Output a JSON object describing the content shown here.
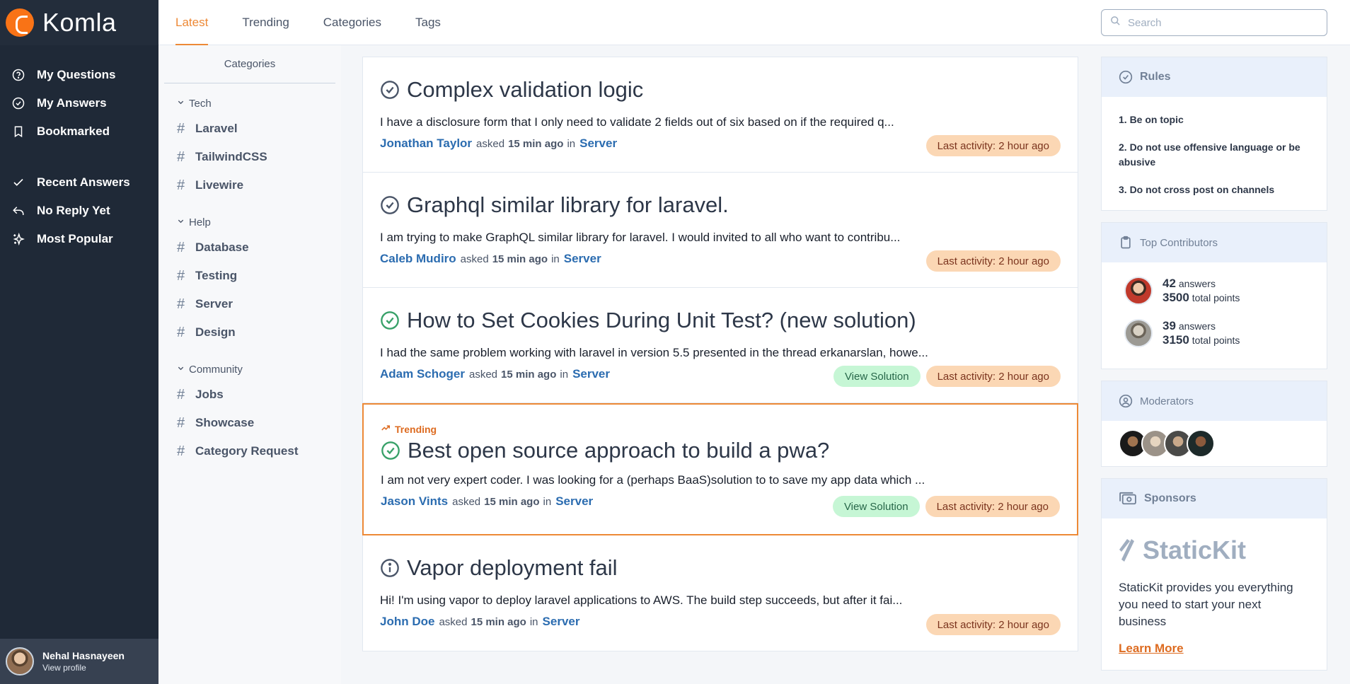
{
  "app": {
    "name": "Komla"
  },
  "nav": {
    "primary": [
      {
        "label": "My Questions",
        "icon": "question-circle-icon"
      },
      {
        "label": "My Answers",
        "icon": "check-circle-icon"
      },
      {
        "label": "Bookmarked",
        "icon": "bookmark-icon"
      }
    ],
    "secondary": [
      {
        "label": "Recent Answers",
        "icon": "check-icon"
      },
      {
        "label": "No Reply Yet",
        "icon": "reply-icon"
      },
      {
        "label": "Most Popular",
        "icon": "sparkle-icon"
      }
    ]
  },
  "profile": {
    "name": "Nehal Hasnayeen",
    "link": "View profile"
  },
  "tabs": [
    "Latest",
    "Trending",
    "Categories",
    "Tags"
  ],
  "active_tab": "Latest",
  "search": {
    "placeholder": "Search"
  },
  "categories": {
    "title": "Categories",
    "groups": [
      {
        "name": "Tech",
        "items": [
          "Laravel",
          "TailwindCSS",
          "Livewire"
        ]
      },
      {
        "name": "Help",
        "items": [
          "Database",
          "Testing",
          "Server",
          "Design"
        ]
      },
      {
        "name": "Community",
        "items": [
          "Jobs",
          "Showcase",
          "Category Request"
        ]
      }
    ]
  },
  "posts": [
    {
      "title": "Complex validation logic",
      "status": "answered",
      "excerpt": "I have a disclosure form that I only need to validate 2 fields out of six based on if the required q...",
      "author": "Jonathan Taylor",
      "asked": "asked",
      "time": "15 min ago",
      "in": "in",
      "channel": "Server",
      "solution": "",
      "activity": "Last activity: 2 hour ago"
    },
    {
      "title": "Graphql similar library for laravel.",
      "status": "answered",
      "excerpt": "I am trying to make GraphQL similar library for laravel. I would invited to all who want to contribu...",
      "author": "Caleb Mudiro",
      "asked": "asked",
      "time": "15 min ago",
      "in": "in",
      "channel": "Server",
      "solution": "",
      "activity": "Last activity: 2 hour ago"
    },
    {
      "title": "How to Set Cookies During Unit Test? (new solution)",
      "status": "solved",
      "excerpt": "I had the same problem working with laravel in version 5.5 presented in the thread erkanarslan, howe...",
      "author": "Adam Schoger",
      "asked": "asked",
      "time": "15 min ago",
      "in": "in",
      "channel": "Server",
      "solution": "View Solution",
      "activity": "Last activity: 2 hour ago"
    },
    {
      "title": "Best open source approach to build a pwa?",
      "status": "solved",
      "trending": "Trending",
      "excerpt": "I am not very expert coder. I was looking for a (perhaps BaaS)solution to to save my app data which ...",
      "author": "Jason Vints",
      "asked": "asked",
      "time": "15 min ago",
      "in": "in",
      "channel": "Server",
      "solution": "View Solution",
      "activity": "Last activity: 2 hour ago"
    },
    {
      "title": "Vapor deployment fail",
      "status": "info",
      "excerpt": "Hi! I'm using vapor to deploy laravel applications to AWS. The build step succeeds, but after it fai...",
      "author": "John Doe",
      "asked": "asked",
      "time": "15 min ago",
      "in": "in",
      "channel": "Server",
      "solution": "",
      "activity": "Last activity: 2 hour ago"
    }
  ],
  "rules": {
    "title": "Rules",
    "items": [
      "1. Be on topic",
      "2. Do not use offensive language or be abusive",
      "3. Do not cross post on channels"
    ]
  },
  "contributors": {
    "title": "Top Contributors",
    "items": [
      {
        "answers": "42",
        "answers_label": "answers",
        "points": "3500",
        "points_label": "total points"
      },
      {
        "answers": "39",
        "answers_label": "answers",
        "points": "3150",
        "points_label": "total points"
      }
    ]
  },
  "moderators": {
    "title": "Moderators",
    "count": 4
  },
  "sponsors": {
    "title": "Sponsors",
    "brand": "StaticKit",
    "text": "StaticKit provides you everything you need to start your next business",
    "link": "Learn More"
  },
  "colors": {
    "accent": "#ed8936",
    "sidebar": "#1f2937",
    "link": "#2b6cb0",
    "success_bg": "#c6f6d5",
    "activity_bg": "#fbd7b4"
  }
}
